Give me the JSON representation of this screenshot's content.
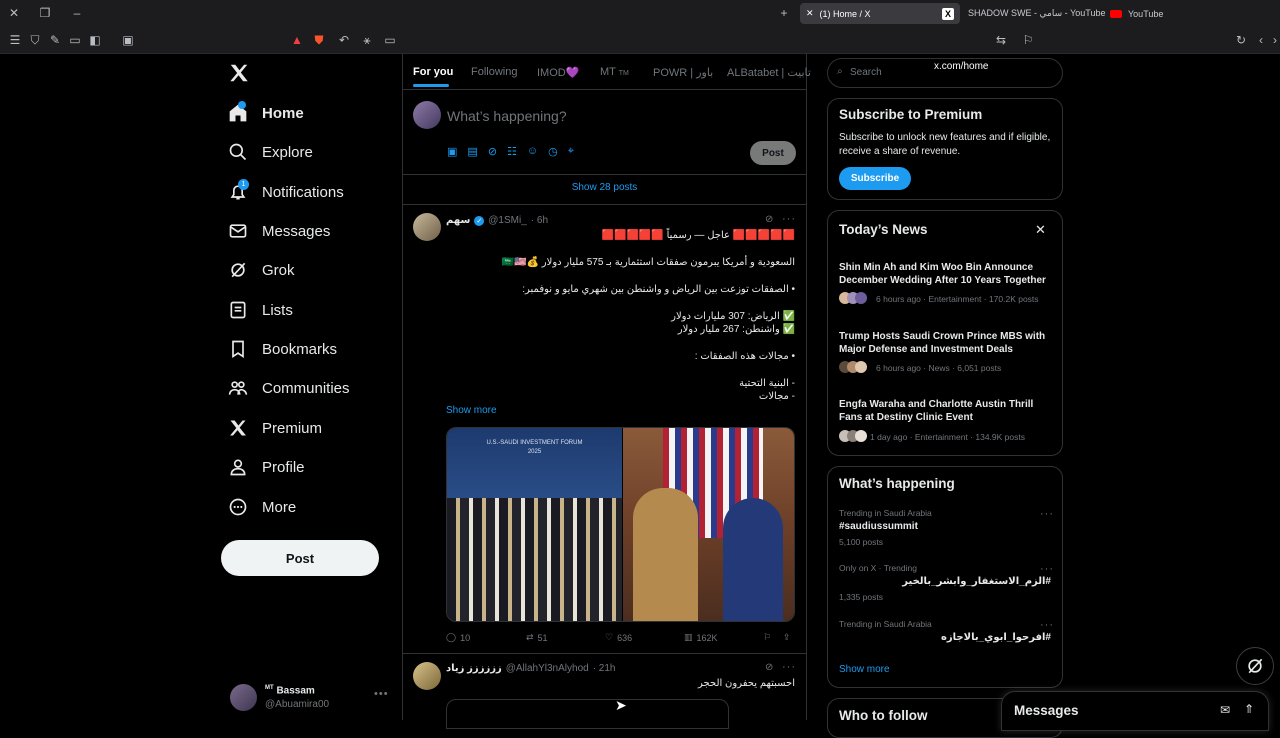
{
  "browser": {
    "tabs": [
      {
        "label": "(1) Home / X"
      },
      {
        "label": "SHADOW SWE - سامي - YouTube"
      },
      {
        "label": "YouTube"
      }
    ],
    "url": "x.com/home"
  },
  "nav": {
    "items": [
      {
        "label": "Home"
      },
      {
        "label": "Explore"
      },
      {
        "label": "Notifications",
        "badge": "1"
      },
      {
        "label": "Messages"
      },
      {
        "label": "Grok"
      },
      {
        "label": "Lists"
      },
      {
        "label": "Bookmarks"
      },
      {
        "label": "Communities"
      },
      {
        "label": "Premium"
      },
      {
        "label": "Profile"
      },
      {
        "label": "More"
      }
    ],
    "post_label": "Post",
    "account": {
      "badge": "MT",
      "name": "Bassam",
      "handle": "@Abuamira00"
    }
  },
  "feed": {
    "tabs": [
      "For you",
      "Following",
      "IMOD💜",
      "MT",
      "POWR | باور",
      "ALBatabet | تابيت"
    ],
    "mt_suffix": "TM",
    "composer_placeholder": "What’s happening?",
    "composer_post": "Post",
    "show_posts": "Show 28 posts",
    "tweet1": {
      "name": "سهم",
      "handle": "@1SMi_",
      "time": "· 6h",
      "lines": [
        "🟥🟥🟥🟥🟥 عاجل — رسمياً 🟥🟥🟥🟥🟥",
        "السعودية و أمريكا يبرمون صفقات استثمارية بـ 575 مليار دولار 💰🇸🇦🇺🇸",
        "• الصفقات توزعت بين الرياض و واشنطن بين شهري مايو و نوفمبر:",
        "✅ الرياض: 307 مليارات دولار",
        "✅ واشنطن: 267 مليار دولار",
        "• مجالات هذه الصفقات :",
        "- البنية التحتية",
        "- مجالات"
      ],
      "show_more": "Show more",
      "image_caption": "U.S.-SAUDI INVESTMENT FORUM",
      "image_year": "2025",
      "replies": "10",
      "reposts": "51",
      "likes": "636",
      "views": "162K"
    },
    "tweet2": {
      "name": "زززززز زياد",
      "handle": "@AllahYl3nAlyhod",
      "time": "· 21h",
      "text": "احسبتهم يحفرون الحجر"
    }
  },
  "right": {
    "search_placeholder": "Search",
    "premium": {
      "title": "Subscribe to Premium",
      "text": "Subscribe to unlock new features and if eligible, receive a share of revenue.",
      "button": "Subscribe"
    },
    "news": {
      "title": "Today’s News",
      "items": [
        {
          "title": "Shin Min Ah and Kim Woo Bin Announce December Wedding After 10 Years Together",
          "meta": "6 hours ago · Entertainment · 170.2K posts"
        },
        {
          "title": "Trump Hosts Saudi Crown Prince MBS with Major Defense and Investment Deals",
          "meta": "6 hours ago · News · 6,051 posts"
        },
        {
          "title": "Engfa Waraha and Charlotte Austin Thrill Fans at Destiny Clinic Event",
          "meta": "1 day ago · Entertainment · 134.9K posts"
        }
      ]
    },
    "happening": {
      "title": "What’s happening",
      "items": [
        {
          "context": "Trending in Saudi Arabia",
          "name": "#saudiussummit",
          "posts": "5,100 posts"
        },
        {
          "context": "Only on X · Trending",
          "name": "#الزم_الاستغفار_وابشر_بالخير",
          "posts": "1,335 posts"
        },
        {
          "context": "Trending in Saudi Arabia",
          "name": "#افرحوا_ابوي_بالاجازه",
          "posts": ""
        }
      ],
      "show_more": "Show more"
    },
    "who_to_follow": "Who to follow",
    "messages": "Messages"
  }
}
